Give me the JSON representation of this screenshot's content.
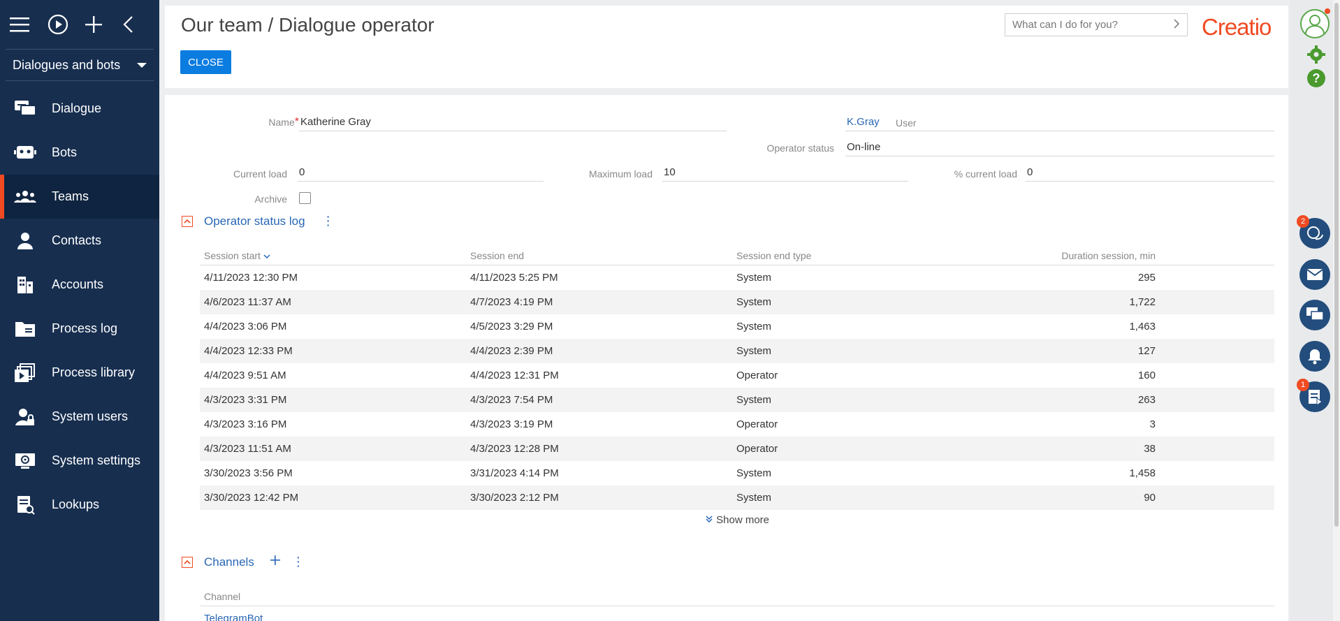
{
  "sidebar": {
    "section": "Dialogues and bots",
    "items": [
      {
        "label": "Dialogue",
        "icon": "dialogue-icon"
      },
      {
        "label": "Bots",
        "icon": "bot-icon"
      },
      {
        "label": "Teams",
        "icon": "teams-icon",
        "active": true
      },
      {
        "label": "Contacts",
        "icon": "contact-icon"
      },
      {
        "label": "Accounts",
        "icon": "accounts-icon"
      },
      {
        "label": "Process log",
        "icon": "process-log-icon"
      },
      {
        "label": "Process library",
        "icon": "process-library-icon"
      },
      {
        "label": "System users",
        "icon": "system-users-icon"
      },
      {
        "label": "System settings",
        "icon": "system-settings-icon"
      },
      {
        "label": "Lookups",
        "icon": "lookups-icon"
      }
    ]
  },
  "header": {
    "title": "Our team / Dialogue operator",
    "close_label": "CLOSE",
    "search_placeholder": "What can I do for you?",
    "logo_text": "Creatio"
  },
  "form": {
    "name_label": "Name",
    "name_value": "Katherine Gray",
    "user_label": "User",
    "user_value": "K.Gray",
    "operator_status_label": "Operator status",
    "operator_status_value": "On-line",
    "current_load_label": "Current load",
    "current_load_value": "0",
    "maximum_load_label": "Maximum load",
    "maximum_load_value": "10",
    "pct_load_label": "% current load",
    "pct_load_value": "0",
    "archive_label": "Archive"
  },
  "status_log": {
    "title": "Operator status log",
    "columns": [
      "Session start",
      "Session end",
      "Session end type",
      "Duration session, min"
    ],
    "rows": [
      [
        "4/11/2023 12:30 PM",
        "4/11/2023 5:25 PM",
        "System",
        "295"
      ],
      [
        "4/6/2023 11:37 AM",
        "4/7/2023 4:19 PM",
        "System",
        "1,722"
      ],
      [
        "4/4/2023 3:06 PM",
        "4/5/2023 3:29 PM",
        "System",
        "1,463"
      ],
      [
        "4/4/2023 12:33 PM",
        "4/4/2023 2:39 PM",
        "System",
        "127"
      ],
      [
        "4/4/2023 9:51 AM",
        "4/4/2023 12:31 PM",
        "Operator",
        "160"
      ],
      [
        "4/3/2023 3:31 PM",
        "4/3/2023 7:54 PM",
        "System",
        "263"
      ],
      [
        "4/3/2023 3:16 PM",
        "4/3/2023 3:19 PM",
        "Operator",
        "3"
      ],
      [
        "4/3/2023 11:51 AM",
        "4/3/2023 12:28 PM",
        "Operator",
        "38"
      ],
      [
        "3/30/2023 3:56 PM",
        "3/31/2023 4:14 PM",
        "System",
        "1,458"
      ],
      [
        "3/30/2023 12:42 PM",
        "3/30/2023 2:12 PM",
        "System",
        "90"
      ]
    ],
    "show_more": "Show more"
  },
  "channels": {
    "title": "Channels",
    "column": "Channel",
    "first_item": "TelegramBot"
  },
  "rail": {
    "badges": {
      "chat": "2",
      "feed": "1"
    }
  },
  "colors": {
    "sidebar": "#172e4f",
    "accent": "#f04b23",
    "primary": "#0b7ce0",
    "link": "#2867b5"
  }
}
